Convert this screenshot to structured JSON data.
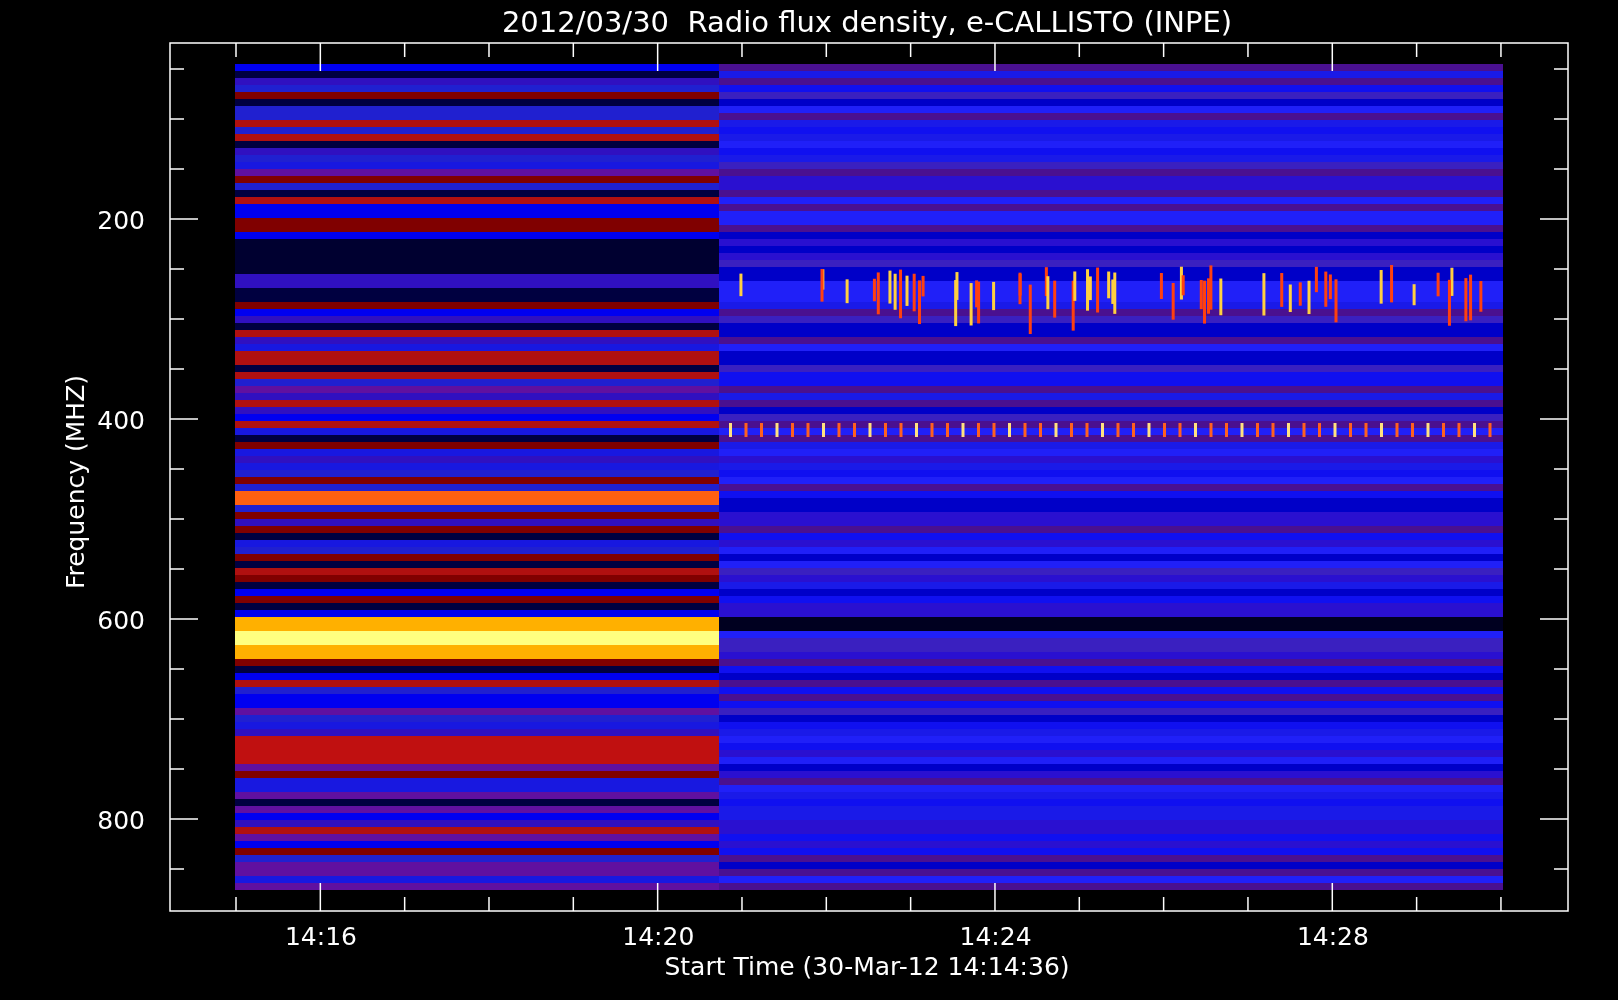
{
  "title": "2012/03/30  Radio flux density, e-CALLISTO (INPE)",
  "y_axis": {
    "label": "Frequency (MHZ)",
    "tick_labels": [
      "200",
      "400",
      "600",
      "800"
    ]
  },
  "x_axis": {
    "label": "Start Time (30-Mar-12 14:14:36)",
    "tick_labels": [
      "14:16",
      "14:20",
      "14:24",
      "14:28"
    ]
  }
}
